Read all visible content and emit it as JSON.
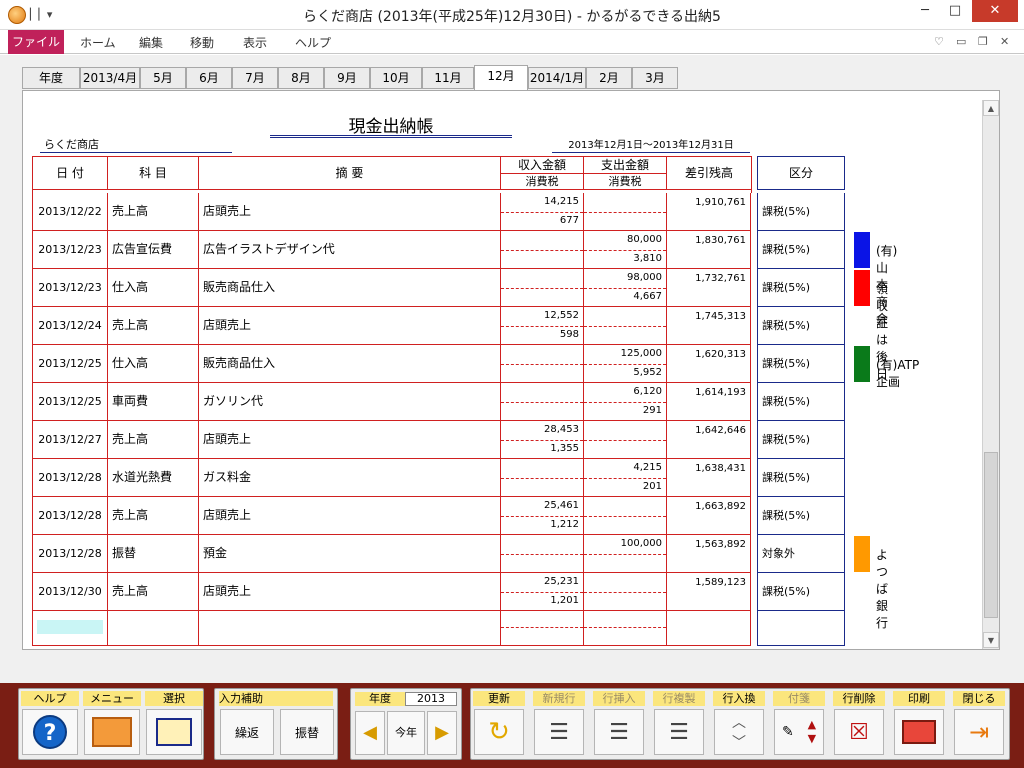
{
  "window": {
    "title": "らくだ商店 (2013年(平成25年)12月30日) - かるがるできる出納5",
    "minimize": "─",
    "maximize": "□",
    "close": "✕"
  },
  "menu": {
    "file": "ファイル",
    "items": [
      "ホーム",
      "編集",
      "移動",
      "表示",
      "ヘルプ"
    ]
  },
  "tabs": [
    "年度",
    "2013/4月",
    "5月",
    "6月",
    "7月",
    "8月",
    "9月",
    "10月",
    "11月",
    "12月",
    "2014/1月",
    "2月",
    "3月"
  ],
  "active_tab": "12月",
  "doc": {
    "title": "現金出納帳",
    "company": "らくだ商店",
    "period": "2013年12月1日～2013年12月31日"
  },
  "headers": {
    "date": "日 付",
    "account": "科 目",
    "memo": "摘 要",
    "income": "収入金額",
    "expense": "支出金額",
    "tax_label": "消費税",
    "balance": "差引残高",
    "category": "区分"
  },
  "rows": [
    {
      "date": "2013/12/22",
      "account": "売上高",
      "memo": "店頭売上",
      "income": "14,215",
      "income_tax": "677",
      "expense": "",
      "expense_tax": "",
      "balance": "1,910,761",
      "category": "課税(5%)",
      "note": "",
      "note_color": ""
    },
    {
      "date": "2013/12/23",
      "account": "広告宣伝費",
      "memo": "広告イラストデザイン代",
      "income": "",
      "income_tax": "",
      "expense": "80,000",
      "expense_tax": "3,810",
      "balance": "1,830,761",
      "category": "課税(5%)",
      "note": "(有)山本商会",
      "note_color": "#0a14e6"
    },
    {
      "date": "2013/12/23",
      "account": "仕入高",
      "memo": "販売商品仕入",
      "income": "",
      "income_tax": "",
      "expense": "98,000",
      "expense_tax": "4,667",
      "balance": "1,732,761",
      "category": "課税(5%)",
      "note": "領収証は後日",
      "note_color": "#ff0000"
    },
    {
      "date": "2013/12/24",
      "account": "売上高",
      "memo": "店頭売上",
      "income": "12,552",
      "income_tax": "598",
      "expense": "",
      "expense_tax": "",
      "balance": "1,745,313",
      "category": "課税(5%)",
      "note": "",
      "note_color": ""
    },
    {
      "date": "2013/12/25",
      "account": "仕入高",
      "memo": "販売商品仕入",
      "income": "",
      "income_tax": "",
      "expense": "125,000",
      "expense_tax": "5,952",
      "balance": "1,620,313",
      "category": "課税(5%)",
      "note": "(有)ATP企画",
      "note_color": "#0a7a1a"
    },
    {
      "date": "2013/12/25",
      "account": "車両費",
      "memo": "ガソリン代",
      "income": "",
      "income_tax": "",
      "expense": "6,120",
      "expense_tax": "291",
      "balance": "1,614,193",
      "category": "課税(5%)",
      "note": "",
      "note_color": ""
    },
    {
      "date": "2013/12/27",
      "account": "売上高",
      "memo": "店頭売上",
      "income": "28,453",
      "income_tax": "1,355",
      "expense": "",
      "expense_tax": "",
      "balance": "1,642,646",
      "category": "課税(5%)",
      "note": "",
      "note_color": ""
    },
    {
      "date": "2013/12/28",
      "account": "水道光熱費",
      "memo": "ガス料金",
      "income": "",
      "income_tax": "",
      "expense": "4,215",
      "expense_tax": "201",
      "balance": "1,638,431",
      "category": "課税(5%)",
      "note": "",
      "note_color": ""
    },
    {
      "date": "2013/12/28",
      "account": "売上高",
      "memo": "店頭売上",
      "income": "25,461",
      "income_tax": "1,212",
      "expense": "",
      "expense_tax": "",
      "balance": "1,663,892",
      "category": "課税(5%)",
      "note": "",
      "note_color": ""
    },
    {
      "date": "2013/12/28",
      "account": "振替",
      "memo": "預金",
      "income": "",
      "income_tax": "",
      "expense": "100,000",
      "expense_tax": "",
      "balance": "1,563,892",
      "category": "対象外",
      "note": "よつば銀行",
      "note_color": "#ff9900"
    },
    {
      "date": "2013/12/30",
      "account": "売上高",
      "memo": "店頭売上",
      "income": "25,231",
      "income_tax": "1,201",
      "expense": "",
      "expense_tax": "",
      "balance": "1,589,123",
      "category": "課税(5%)",
      "note": "",
      "note_color": ""
    }
  ],
  "toolbar": {
    "help": "ヘルプ",
    "menu": "メニュー",
    "select": "選択",
    "input_assist": "入力補助",
    "repeat": "繰返",
    "transfer": "振替",
    "year_label": "年度",
    "year_value": "2013",
    "this_year": "今年",
    "update": "更新",
    "new_row": "新規行",
    "insert_row": "行挿入",
    "copy_row": "行複製",
    "swap_row": "行入換",
    "sticky": "付箋",
    "delete_row": "行削除",
    "print": "印刷",
    "close": "閉じる"
  }
}
